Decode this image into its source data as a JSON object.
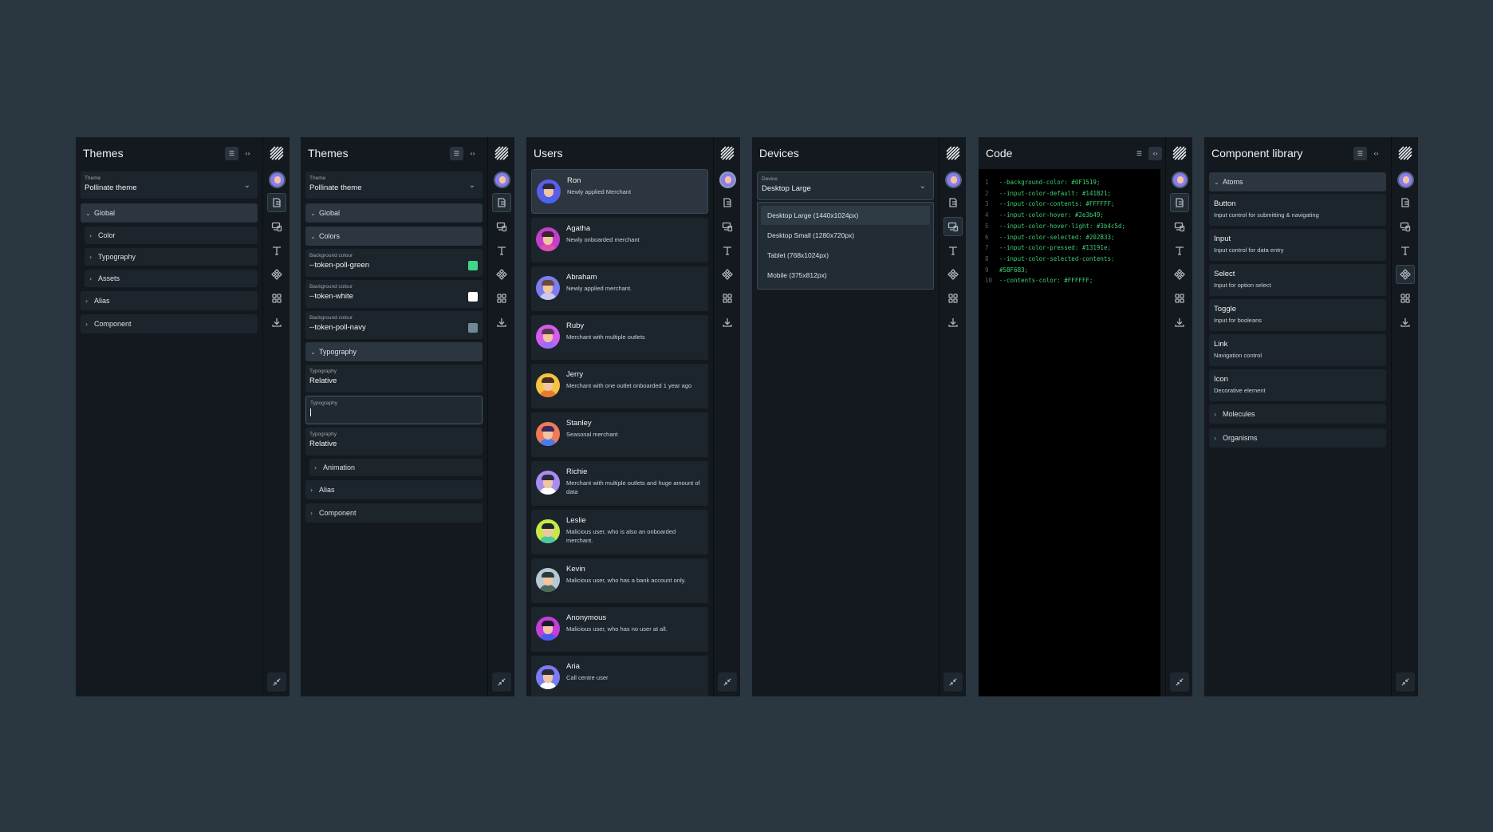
{
  "colors": {
    "page_bg": "#2a3640",
    "panel_bg": "#13191e",
    "field_bg": "#1d252c",
    "accent_code": "#3fcf74"
  },
  "rail_icons": [
    "pollinate-logo",
    "avatar",
    "theme-icon",
    "devices-icon",
    "typography-icon",
    "components-icon",
    "grid-icon",
    "download-icon",
    "collapse-icon"
  ],
  "panel1": {
    "title": "Themes",
    "theme_label": "Theme",
    "theme_value": "Pollinate theme",
    "rows": {
      "global": "Global",
      "color": "Color",
      "typography": "Typography",
      "assets": "Assets",
      "alias": "Alias",
      "component": "Component"
    }
  },
  "panel2": {
    "title": "Themes",
    "theme_label": "Theme",
    "theme_value": "Pollinate theme",
    "rows": {
      "global": "Global",
      "colors": "Colors",
      "typography": "Typography",
      "animation": "Animation",
      "alias": "Alias",
      "component": "Component"
    },
    "color_fields": [
      {
        "label": "Background colour",
        "value": "--token-poll-green",
        "swatch": "#3fd58a"
      },
      {
        "label": "Background colour",
        "value": "--token-white",
        "swatch": "#ffffff"
      },
      {
        "label": "Background colour",
        "value": "--token-poll-navy",
        "swatch": "#6e8a98"
      }
    ],
    "typo_fields": [
      {
        "label": "Typography",
        "value": "Relative"
      },
      {
        "label": "Typography",
        "value": ""
      },
      {
        "label": "Typography",
        "value": "Relative"
      }
    ]
  },
  "panel3": {
    "title": "Users",
    "users": [
      {
        "name": "Ron",
        "desc": "Newly applied Merchant"
      },
      {
        "name": "Agatha",
        "desc": "Newly onboarded merchant"
      },
      {
        "name": "Abraham",
        "desc": "Newly applied merchant."
      },
      {
        "name": "Ruby",
        "desc": "Merchant with multiple outlets"
      },
      {
        "name": "Jerry",
        "desc": "Merchant with one outlet onboarded 1 year ago"
      },
      {
        "name": "Stanley",
        "desc": "Seasonal merchant"
      },
      {
        "name": "Richie",
        "desc": "Merchant with multiple outlets and huge amount of data"
      },
      {
        "name": "Leslie",
        "desc": "Malicious user, who is also an onboarded merchant."
      },
      {
        "name": "Kevin",
        "desc": "Malicious user, who has a bank account only."
      },
      {
        "name": "Anonymous",
        "desc": "Malicious user, who has no user at all."
      },
      {
        "name": "Aria",
        "desc": "Call centre user"
      }
    ]
  },
  "panel4": {
    "title": "Devices",
    "device_label": "Device",
    "device_value": "Desktop Large",
    "options": [
      "Desktop Large (1440x1024px)",
      "Desktop Small (1280x720px)",
      "Tablet (768x1024px)",
      "Mobile (375x812px)"
    ]
  },
  "panel5": {
    "title": "Code",
    "lines": [
      {
        "n": "1",
        "t": "--background-color: #0F1519;"
      },
      {
        "n": "2",
        "t": "--input-color-default: #141B21;"
      },
      {
        "n": "3",
        "t": "--input-color-contents: #FFFFFF;"
      },
      {
        "n": "4",
        "t": "--input-color-hover: #2e3b49;"
      },
      {
        "n": "5",
        "t": "--input-color-hover-light: #3b4c5d;"
      },
      {
        "n": "6",
        "t": "--input-color-selected: #202B33;"
      },
      {
        "n": "7",
        "t": "--input-color-pressed: #13191e;"
      },
      {
        "n": "8",
        "t": "--input-color-selected-contents:"
      },
      {
        "n": "9",
        "t": "#5BF6B3;"
      },
      {
        "n": "10",
        "t": "--contents-color: #FFFFFF;"
      }
    ]
  },
  "panel6": {
    "title": "Component library",
    "atoms": "Atoms",
    "components": [
      {
        "title": "Button",
        "desc": "Input control for submitting & navigating"
      },
      {
        "title": "Input",
        "desc": "Input control for data entry"
      },
      {
        "title": "Select",
        "desc": "Input for option select"
      },
      {
        "title": "Toggle",
        "desc": "Input for booleans"
      },
      {
        "title": "Link",
        "desc": "Navigation control"
      },
      {
        "title": "Icon",
        "desc": "Decorative element"
      }
    ],
    "molecules": "Molecules",
    "organisms": "Organisms"
  }
}
